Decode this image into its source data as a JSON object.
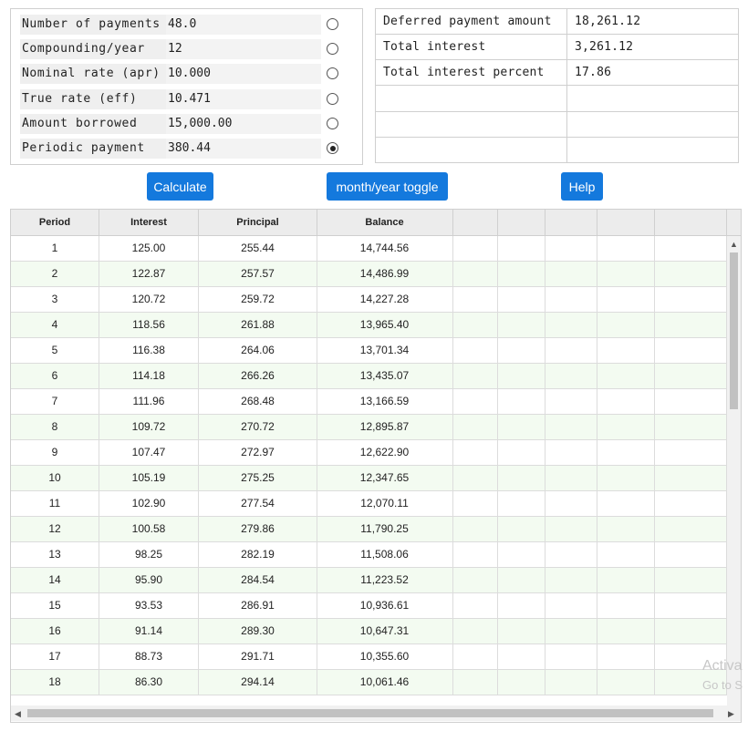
{
  "inputs": [
    {
      "label": "Number of payments",
      "value": "48.0",
      "selected": false
    },
    {
      "label": "Compounding/year",
      "value": "12",
      "selected": false
    },
    {
      "label": "Nominal rate (apr)",
      "value": "10.000",
      "selected": false
    },
    {
      "label": "True rate (eff)",
      "value": "10.471",
      "selected": false
    },
    {
      "label": "Amount borrowed",
      "value": "15,000.00",
      "selected": false
    },
    {
      "label": "Periodic payment",
      "value": "380.44",
      "selected": true
    }
  ],
  "results": [
    {
      "label": "Deferred payment amount",
      "value": "18,261.12"
    },
    {
      "label": "Total interest",
      "value": "3,261.12"
    },
    {
      "label": "Total interest percent",
      "value": "17.86"
    },
    {
      "label": "",
      "value": ""
    },
    {
      "label": "",
      "value": ""
    },
    {
      "label": "",
      "value": ""
    }
  ],
  "buttons": {
    "calculate": "Calculate",
    "toggle": "month/year toggle",
    "help": "Help"
  },
  "table": {
    "headers": [
      "Period",
      "Interest",
      "Principal",
      "Balance",
      "",
      "",
      "",
      "",
      ""
    ],
    "rows": [
      [
        "1",
        "125.00",
        "255.44",
        "14,744.56"
      ],
      [
        "2",
        "122.87",
        "257.57",
        "14,486.99"
      ],
      [
        "3",
        "120.72",
        "259.72",
        "14,227.28"
      ],
      [
        "4",
        "118.56",
        "261.88",
        "13,965.40"
      ],
      [
        "5",
        "116.38",
        "264.06",
        "13,701.34"
      ],
      [
        "6",
        "114.18",
        "266.26",
        "13,435.07"
      ],
      [
        "7",
        "111.96",
        "268.48",
        "13,166.59"
      ],
      [
        "8",
        "109.72",
        "270.72",
        "12,895.87"
      ],
      [
        "9",
        "107.47",
        "272.97",
        "12,622.90"
      ],
      [
        "10",
        "105.19",
        "275.25",
        "12,347.65"
      ],
      [
        "11",
        "102.90",
        "277.54",
        "12,070.11"
      ],
      [
        "12",
        "100.58",
        "279.86",
        "11,790.25"
      ],
      [
        "13",
        "98.25",
        "282.19",
        "11,508.06"
      ],
      [
        "14",
        "95.90",
        "284.54",
        "11,223.52"
      ],
      [
        "15",
        "93.53",
        "286.91",
        "10,936.61"
      ],
      [
        "16",
        "91.14",
        "289.30",
        "10,647.31"
      ],
      [
        "17",
        "88.73",
        "291.71",
        "10,355.60"
      ],
      [
        "18",
        "86.30",
        "294.14",
        "10,061.46"
      ]
    ]
  },
  "watermark": {
    "line1": "Activa",
    "line2": "Go to S"
  },
  "icons": {
    "scroll_up": "chevron-up-icon",
    "scroll_left": "chevron-left-icon",
    "scroll_right": "chevron-right-icon"
  },
  "colors": {
    "button": "#1479dd",
    "row_alt": "#f3fbf1",
    "header": "#ececec"
  }
}
